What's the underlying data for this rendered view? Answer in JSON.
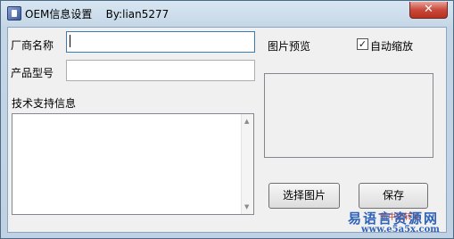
{
  "window": {
    "title": "OEM信息设置    By:lian5277",
    "close_symbol": "✕"
  },
  "form": {
    "manufacturer_label": "厂商名称",
    "manufacturer_value": "",
    "model_label": "产品型号",
    "model_value": "",
    "support_label": "技术支持信息",
    "support_value": ""
  },
  "preview": {
    "label": "图片预览",
    "auto_scale_label": "自动缩放",
    "auto_scale_checked": true,
    "check_mark": "✓"
  },
  "buttons": {
    "select_image": "选择图片",
    "save": "保存"
  },
  "watermark": {
    "site_name": "易语言资源网",
    "url": "www.e5a5x.com",
    "stamp": "新中国转发"
  },
  "colors": {
    "title_gradient_top": "#d8e6f2",
    "close_button": "#c9493a",
    "watermark": "#2f63b8"
  }
}
